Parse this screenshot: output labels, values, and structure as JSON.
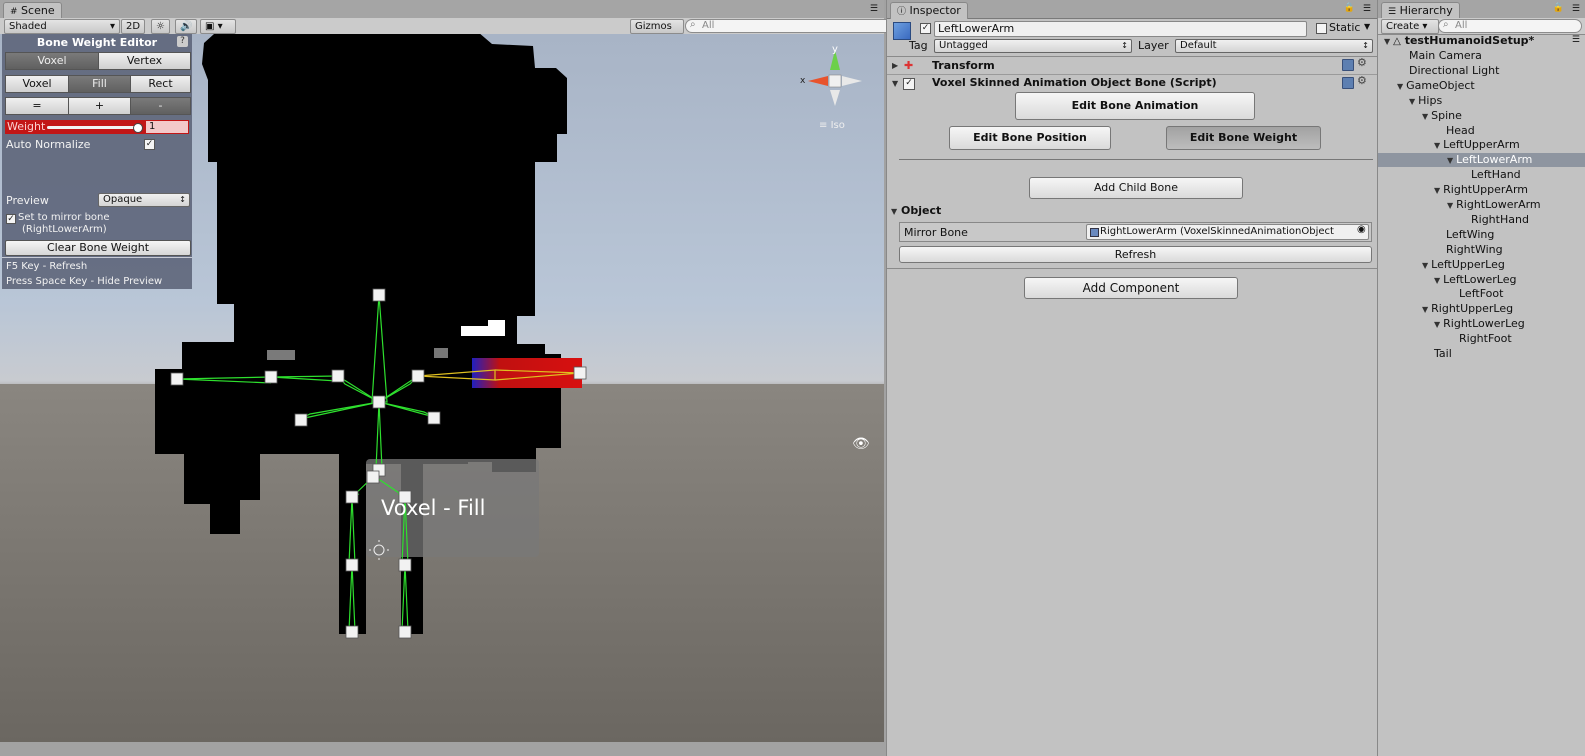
{
  "scene": {
    "tab": "Scene",
    "shading": "Shaded",
    "mode2d": "2D",
    "gizmos": "Gizmos",
    "search_placeholder": "All",
    "overlay_label": "Voxel - Fill",
    "view_mode": "Iso",
    "axis_x": "x",
    "axis_y": "y"
  },
  "bone_weight_editor": {
    "title": "Bone Weight Editor",
    "help": "?",
    "mode_tabs": [
      "Voxel",
      "Vertex"
    ],
    "tool_tabs": [
      "Voxel",
      "Fill",
      "Rect"
    ],
    "op_tabs": [
      "=",
      "+",
      "-"
    ],
    "weight_label": "Weight",
    "weight_value": "1",
    "auto_normalize_label": "Auto Normalize",
    "preview_label": "Preview",
    "preview_value": "Opaque",
    "mirror_label_1": "Set to mirror bone",
    "mirror_label_2": "(RightLowerArm)",
    "clear_button": "Clear Bone Weight",
    "hint_1": "F5 Key - Refresh",
    "hint_2": "Press Space Key - Hide Preview"
  },
  "inspector": {
    "tab": "Inspector",
    "object_name": "LeftLowerArm",
    "static_label": "Static",
    "tag_label": "Tag",
    "tag_value": "Untagged",
    "layer_label": "Layer",
    "layer_value": "Default",
    "transform_label": "Transform",
    "script_label": "Voxel Skinned Animation Object Bone (Script)",
    "edit_anim_button": "Edit Bone Animation",
    "edit_pos_button": "Edit Bone Position",
    "edit_weight_button": "Edit Bone Weight",
    "add_child_button": "Add Child Bone",
    "object_section": "Object",
    "mirror_bone_label": "Mirror Bone",
    "mirror_bone_value": "RightLowerArm (VoxelSkinnedAnimationObject",
    "refresh_button": "Refresh",
    "add_component_button": "Add Component"
  },
  "hierarchy": {
    "tab": "Hierarchy",
    "create": "Create",
    "search_placeholder": "All",
    "root": "testHumanoidSetup*",
    "items": [
      {
        "label": "Main Camera",
        "depth": 1,
        "arrow": false
      },
      {
        "label": "Directional Light",
        "depth": 1,
        "arrow": false
      },
      {
        "label": "GameObject",
        "depth": 1,
        "arrow": true
      },
      {
        "label": "Hips",
        "depth": 2,
        "arrow": true
      },
      {
        "label": "Spine",
        "depth": 3,
        "arrow": true
      },
      {
        "label": "Head",
        "depth": 4,
        "arrow": false
      },
      {
        "label": "LeftUpperArm",
        "depth": 4,
        "arrow": true
      },
      {
        "label": "LeftLowerArm",
        "depth": 5,
        "arrow": true,
        "selected": true
      },
      {
        "label": "LeftHand",
        "depth": 6,
        "arrow": false
      },
      {
        "label": "RightUpperArm",
        "depth": 4,
        "arrow": true
      },
      {
        "label": "RightLowerArm",
        "depth": 5,
        "arrow": true
      },
      {
        "label": "RightHand",
        "depth": 6,
        "arrow": false
      },
      {
        "label": "LeftWing",
        "depth": 4,
        "arrow": false
      },
      {
        "label": "RightWing",
        "depth": 4,
        "arrow": false
      },
      {
        "label": "LeftUpperLeg",
        "depth": 3,
        "arrow": true
      },
      {
        "label": "LeftLowerLeg",
        "depth": 4,
        "arrow": true
      },
      {
        "label": "LeftFoot",
        "depth": 5,
        "arrow": false
      },
      {
        "label": "RightUpperLeg",
        "depth": 3,
        "arrow": true
      },
      {
        "label": "RightLowerLeg",
        "depth": 4,
        "arrow": true
      },
      {
        "label": "RightFoot",
        "depth": 5,
        "arrow": false
      },
      {
        "label": "Tail",
        "depth": 3,
        "arrow": false
      }
    ]
  }
}
